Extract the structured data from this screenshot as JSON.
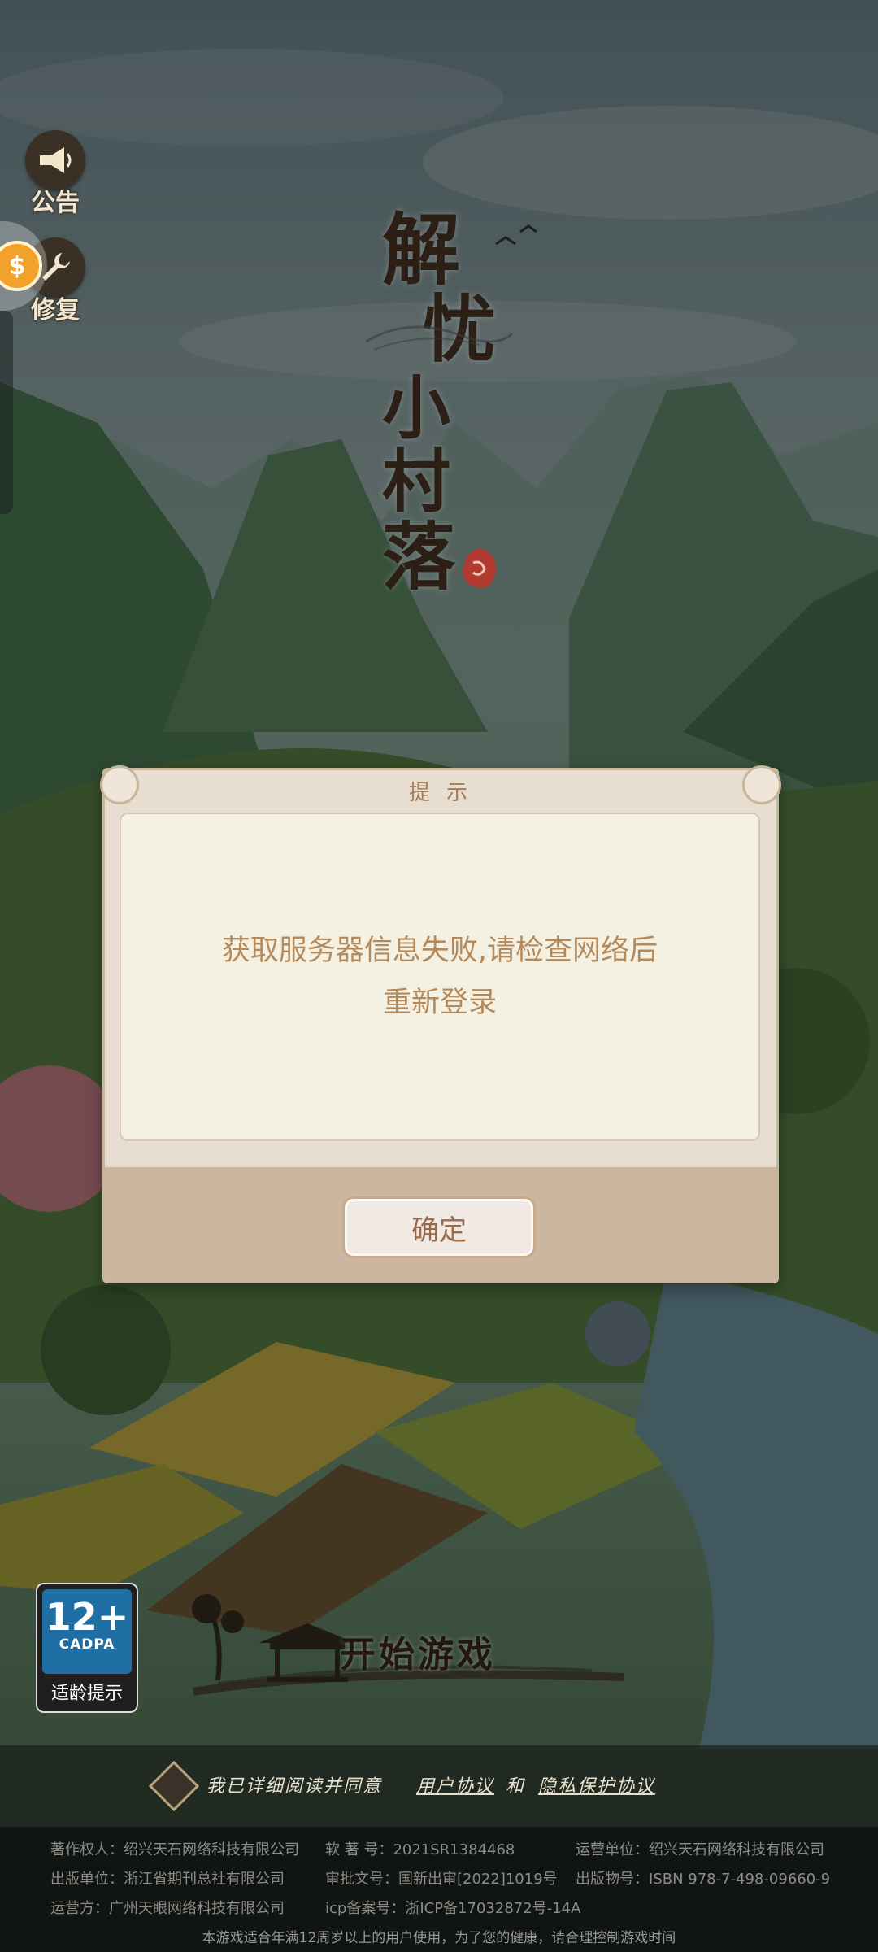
{
  "sidebar": {
    "notice_label": "公告",
    "repair_label": "修复"
  },
  "logo": {
    "chars": [
      "解",
      "忧",
      "小",
      "村",
      "落"
    ]
  },
  "dialog": {
    "title": "提 示",
    "message_line1": "获取服务器信息失败,请检查网络后",
    "message_line2": "重新登录",
    "confirm_label": "确定"
  },
  "age_rating": {
    "age": "12+",
    "org": "CADPA",
    "tip": "适龄提示"
  },
  "start_button": {
    "label": "开始游戏"
  },
  "agreement": {
    "text": "我已详细阅读并同意",
    "user_agreement": "用户协议",
    "and": "和",
    "privacy_policy": "隐私保护协议"
  },
  "copyright": {
    "copyright_owner": "著作权人：绍兴天石网络科技有限公司",
    "software_reg": "软 著 号：2021SR1384468",
    "operator_unit": "运营单位：绍兴天石网络科技有限公司",
    "publisher": "出版单位：浙江省期刊总社有限公司",
    "approval_no": "审批文号：国新出审[2022]1019号",
    "publication_no": "出版物号：ISBN 978-7-498-09660-9",
    "operator": "运营方：广州天眼网络科技有限公司",
    "icp": "icp备案号：浙ICP备17032872号-14A",
    "health_notice": "本游戏适合年满12周岁以上的用户使用，为了您的健康，请合理控制游戏时间"
  }
}
